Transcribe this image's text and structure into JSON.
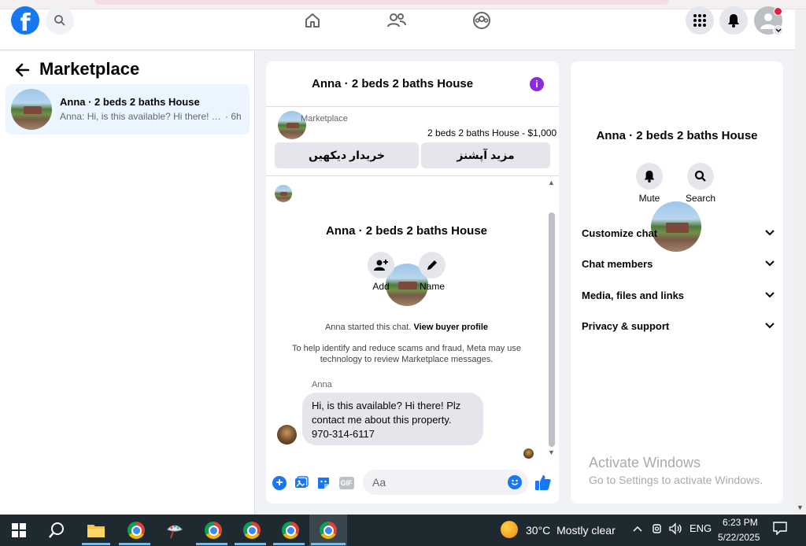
{
  "colors": {
    "accent": "#1877f2",
    "info": "#8a2be2",
    "active_bg": "#ebf5ff"
  },
  "header": {
    "logo_glyph": "f",
    "icons": [
      "search-icon",
      "home-icon",
      "friends-icon",
      "groups-icon",
      "menu-grid-icon",
      "bell-icon",
      "profile-icon"
    ]
  },
  "left": {
    "title": "Marketplace",
    "conversation": {
      "title": "Anna · 2 beds 2 baths House",
      "preview": "Anna: Hi, is this available? Hi there! Pl...",
      "time": "· 6h"
    }
  },
  "chat": {
    "title": "Anna · 2 beds 2 baths House",
    "marketplace_label": "Marketplace",
    "listing_price": "2 beds 2 baths House - $1,000",
    "button_buyer": "خریدار دیکھیں",
    "button_more": "مزید آپشنز",
    "intro_title": "Anna · 2 beds 2 baths House",
    "action_add": "Add",
    "action_name": "Name",
    "started_text": "Anna started this chat.",
    "view_buyer_link": "View buyer profile",
    "notice": "To help identify and reduce scams and fraud, Meta may use technology to review Marketplace messages.",
    "sender": "Anna",
    "message_line1": "Hi, is this available? Hi there! Plz",
    "message_line2": "contact me about this property.",
    "message_line3": "970-314-6117",
    "composer_placeholder": "Aa",
    "gif_label": "GIF"
  },
  "right": {
    "title": "Anna · 2 beds 2 baths House",
    "mute_label": "Mute",
    "search_label": "Search",
    "menu": [
      "Customize chat",
      "Chat members",
      "Media, files and links",
      "Privacy & support"
    ]
  },
  "watermark": {
    "line1": "Activate Windows",
    "line2": "Go to Settings to activate Windows."
  },
  "taskbar": {
    "temperature": "30°C",
    "weather": "Mostly clear",
    "language": "ENG",
    "time": "6:23 PM",
    "date": "5/22/2025"
  }
}
